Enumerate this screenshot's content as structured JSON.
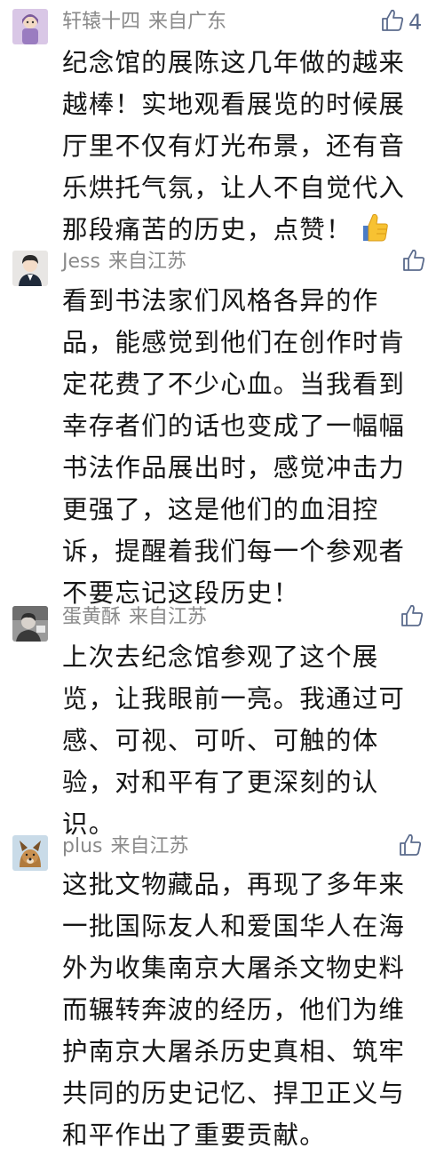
{
  "comments": [
    {
      "author": "轩辕十四",
      "location": "来自广东",
      "like_count": "4",
      "lines": [
        "纪念馆的展陈这几年做的越来",
        "越棒！实地观看展览的时候展",
        "厅里不仅有灯光布景，还有音",
        "乐烘托气氛，让人不自觉代入",
        "那段痛苦的历史，点赞！"
      ],
      "emoji": "thumbs-up-emoji"
    },
    {
      "author": "Jess",
      "location": "来自江苏",
      "like_count": "",
      "lines": [
        "看到书法家们风格各异的作",
        "品，能感觉到他们在创作时肯",
        "定花费了不少心血。当我看到",
        "幸存者们的话也变成了一幅幅",
        "书法作品展出时，感觉冲击力",
        "更强了，这是他们的血泪控",
        "诉，提醒着我们每一个参观者",
        "不要忘记这段历史！"
      ]
    },
    {
      "author": "蛋黄酥",
      "location": "来自江苏",
      "like_count": "",
      "lines": [
        "上次去纪念馆参观了这个展",
        "览，让我眼前一亮。我通过可",
        "感、可视、可听、可触的体",
        "验，对和平有了更深刻的认",
        "识。"
      ]
    },
    {
      "author": "plus",
      "location": "来自江苏",
      "like_count": "",
      "lines": [
        "这批文物藏品，再现了多年来",
        "一批国际友人和爱国华人在海",
        "外为收集南京大屠杀文物史料",
        "而辗转奔波的经历，他们为维",
        "护南京大屠杀历史真相、筑牢",
        "共同的历史记忆、捍卫正义与",
        "和平作出了重要贡献。"
      ]
    }
  ],
  "colors": {
    "meta_text": "#8a8a8a",
    "body_text": "#161616",
    "like_icon": "#5b6b8c"
  }
}
